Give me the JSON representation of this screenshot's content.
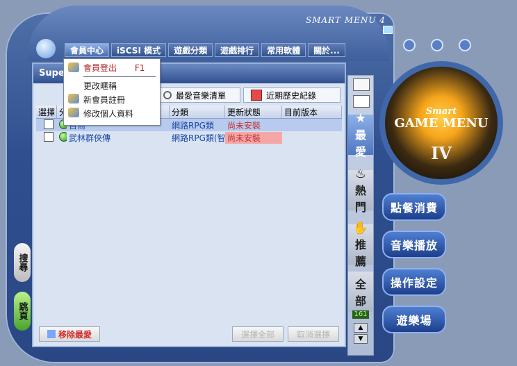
{
  "app": {
    "brand_text": "SMART MENU 4"
  },
  "header": {
    "tabs": [
      {
        "label": "會員中心"
      },
      {
        "label": "iSCSI 模式"
      },
      {
        "label": "遊戲分類"
      },
      {
        "label": "遊戲排行"
      },
      {
        "label": "常用軟體"
      },
      {
        "label": "關於..."
      }
    ]
  },
  "dropdown": {
    "items": [
      {
        "label": "會員登出",
        "shortcut": "F1"
      },
      {
        "label": "更改暱稱"
      },
      {
        "label": "新會員註冊"
      },
      {
        "label": "修改個人資料"
      }
    ]
  },
  "content": {
    "title": "Super",
    "subtabs": [
      {
        "label": "最愛音樂清單"
      },
      {
        "label": "近期歷史紀錄"
      }
    ],
    "columns": [
      "選擇",
      "分",
      "",
      "分類",
      "更新狀態",
      "目前版本"
    ],
    "rows": [
      {
        "name": "百商",
        "category": "網路RPG類",
        "status": "尚未安裝",
        "version": ""
      },
      {
        "name": "武林群俠傳",
        "category": "網路RPG類(智",
        "status": "尚未安裝",
        "version": ""
      }
    ],
    "footer": {
      "remove": "移除最愛",
      "select_all": "選擇全部",
      "cancel_select": "取消選擇"
    }
  },
  "sidebar": {
    "buttons": [
      {
        "label": "最\n愛"
      },
      {
        "label": "熱\n門"
      },
      {
        "label": "推\n薦"
      },
      {
        "label": "全\n部"
      }
    ],
    "counter": "161"
  },
  "right_panel": {
    "logo_top": "Smart",
    "logo_main": "GAME MENU",
    "logo_roman": "IV",
    "buttons": [
      {
        "label": "點餐消費"
      },
      {
        "label": "音樂播放"
      },
      {
        "label": "操作設定"
      },
      {
        "label": "遊樂場"
      }
    ]
  },
  "left_pills": [
    {
      "label": "搜尋"
    },
    {
      "label": "跳頁"
    }
  ]
}
